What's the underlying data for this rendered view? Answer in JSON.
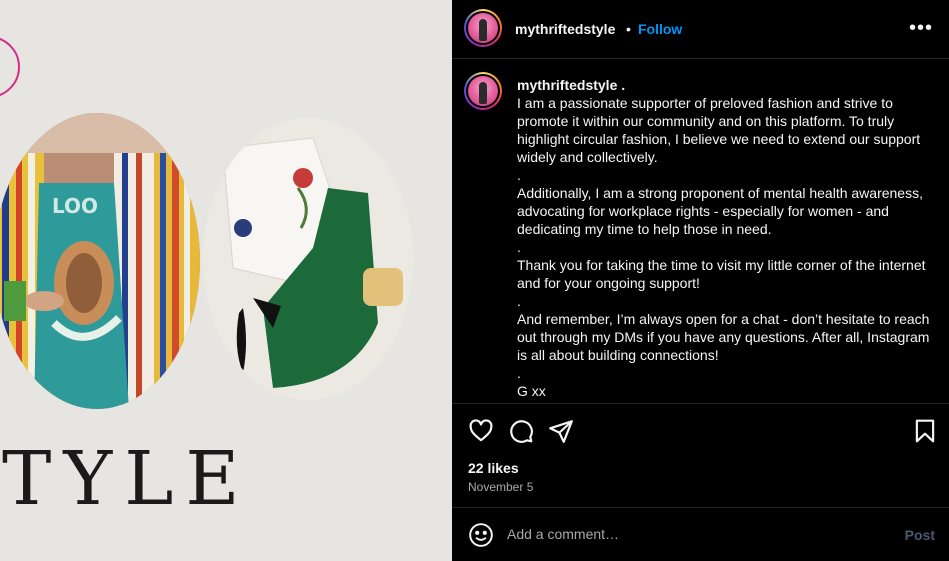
{
  "media": {
    "overlay_text": "TYLE"
  },
  "header": {
    "username": "mythriftedstyle",
    "separator": "•",
    "follow_label": "Follow",
    "more_label": "•••"
  },
  "caption": {
    "username": "mythriftedstyle",
    "username_suffix": " .",
    "paragraphs": [
      "I am a passionate supporter of preloved fashion and strive to promote it within our community and on this platform. To truly highlight circular fashion, I believe we need to extend our support widely and collectively.",
      ".",
      "Additionally, I am a strong proponent of mental health awareness, advocating for workplace rights - especially for women - and dedicating my time to help those in need.",
      ".",
      "Thank you for taking the time to visit my little corner of the internet and for your ongoing support!",
      ".",
      "And remember, I’m always open for a chat - don’t hesitate to reach out through my DMs if you have any questions. After all, Instagram is all about building connections!",
      ".",
      "G xx"
    ]
  },
  "actions": {
    "icons": [
      "heart-icon",
      "comment-icon",
      "share-icon",
      "bookmark-icon"
    ],
    "likes": "22 likes",
    "date": "November 5"
  },
  "comment": {
    "placeholder": "Add a comment…",
    "post_label": "Post"
  },
  "colors": {
    "background": "#000000",
    "link_blue": "#0095f6",
    "muted_text": "#a8a8a8",
    "post_disabled": "#4a5a6e",
    "accent_pink": "#d62c8a"
  }
}
